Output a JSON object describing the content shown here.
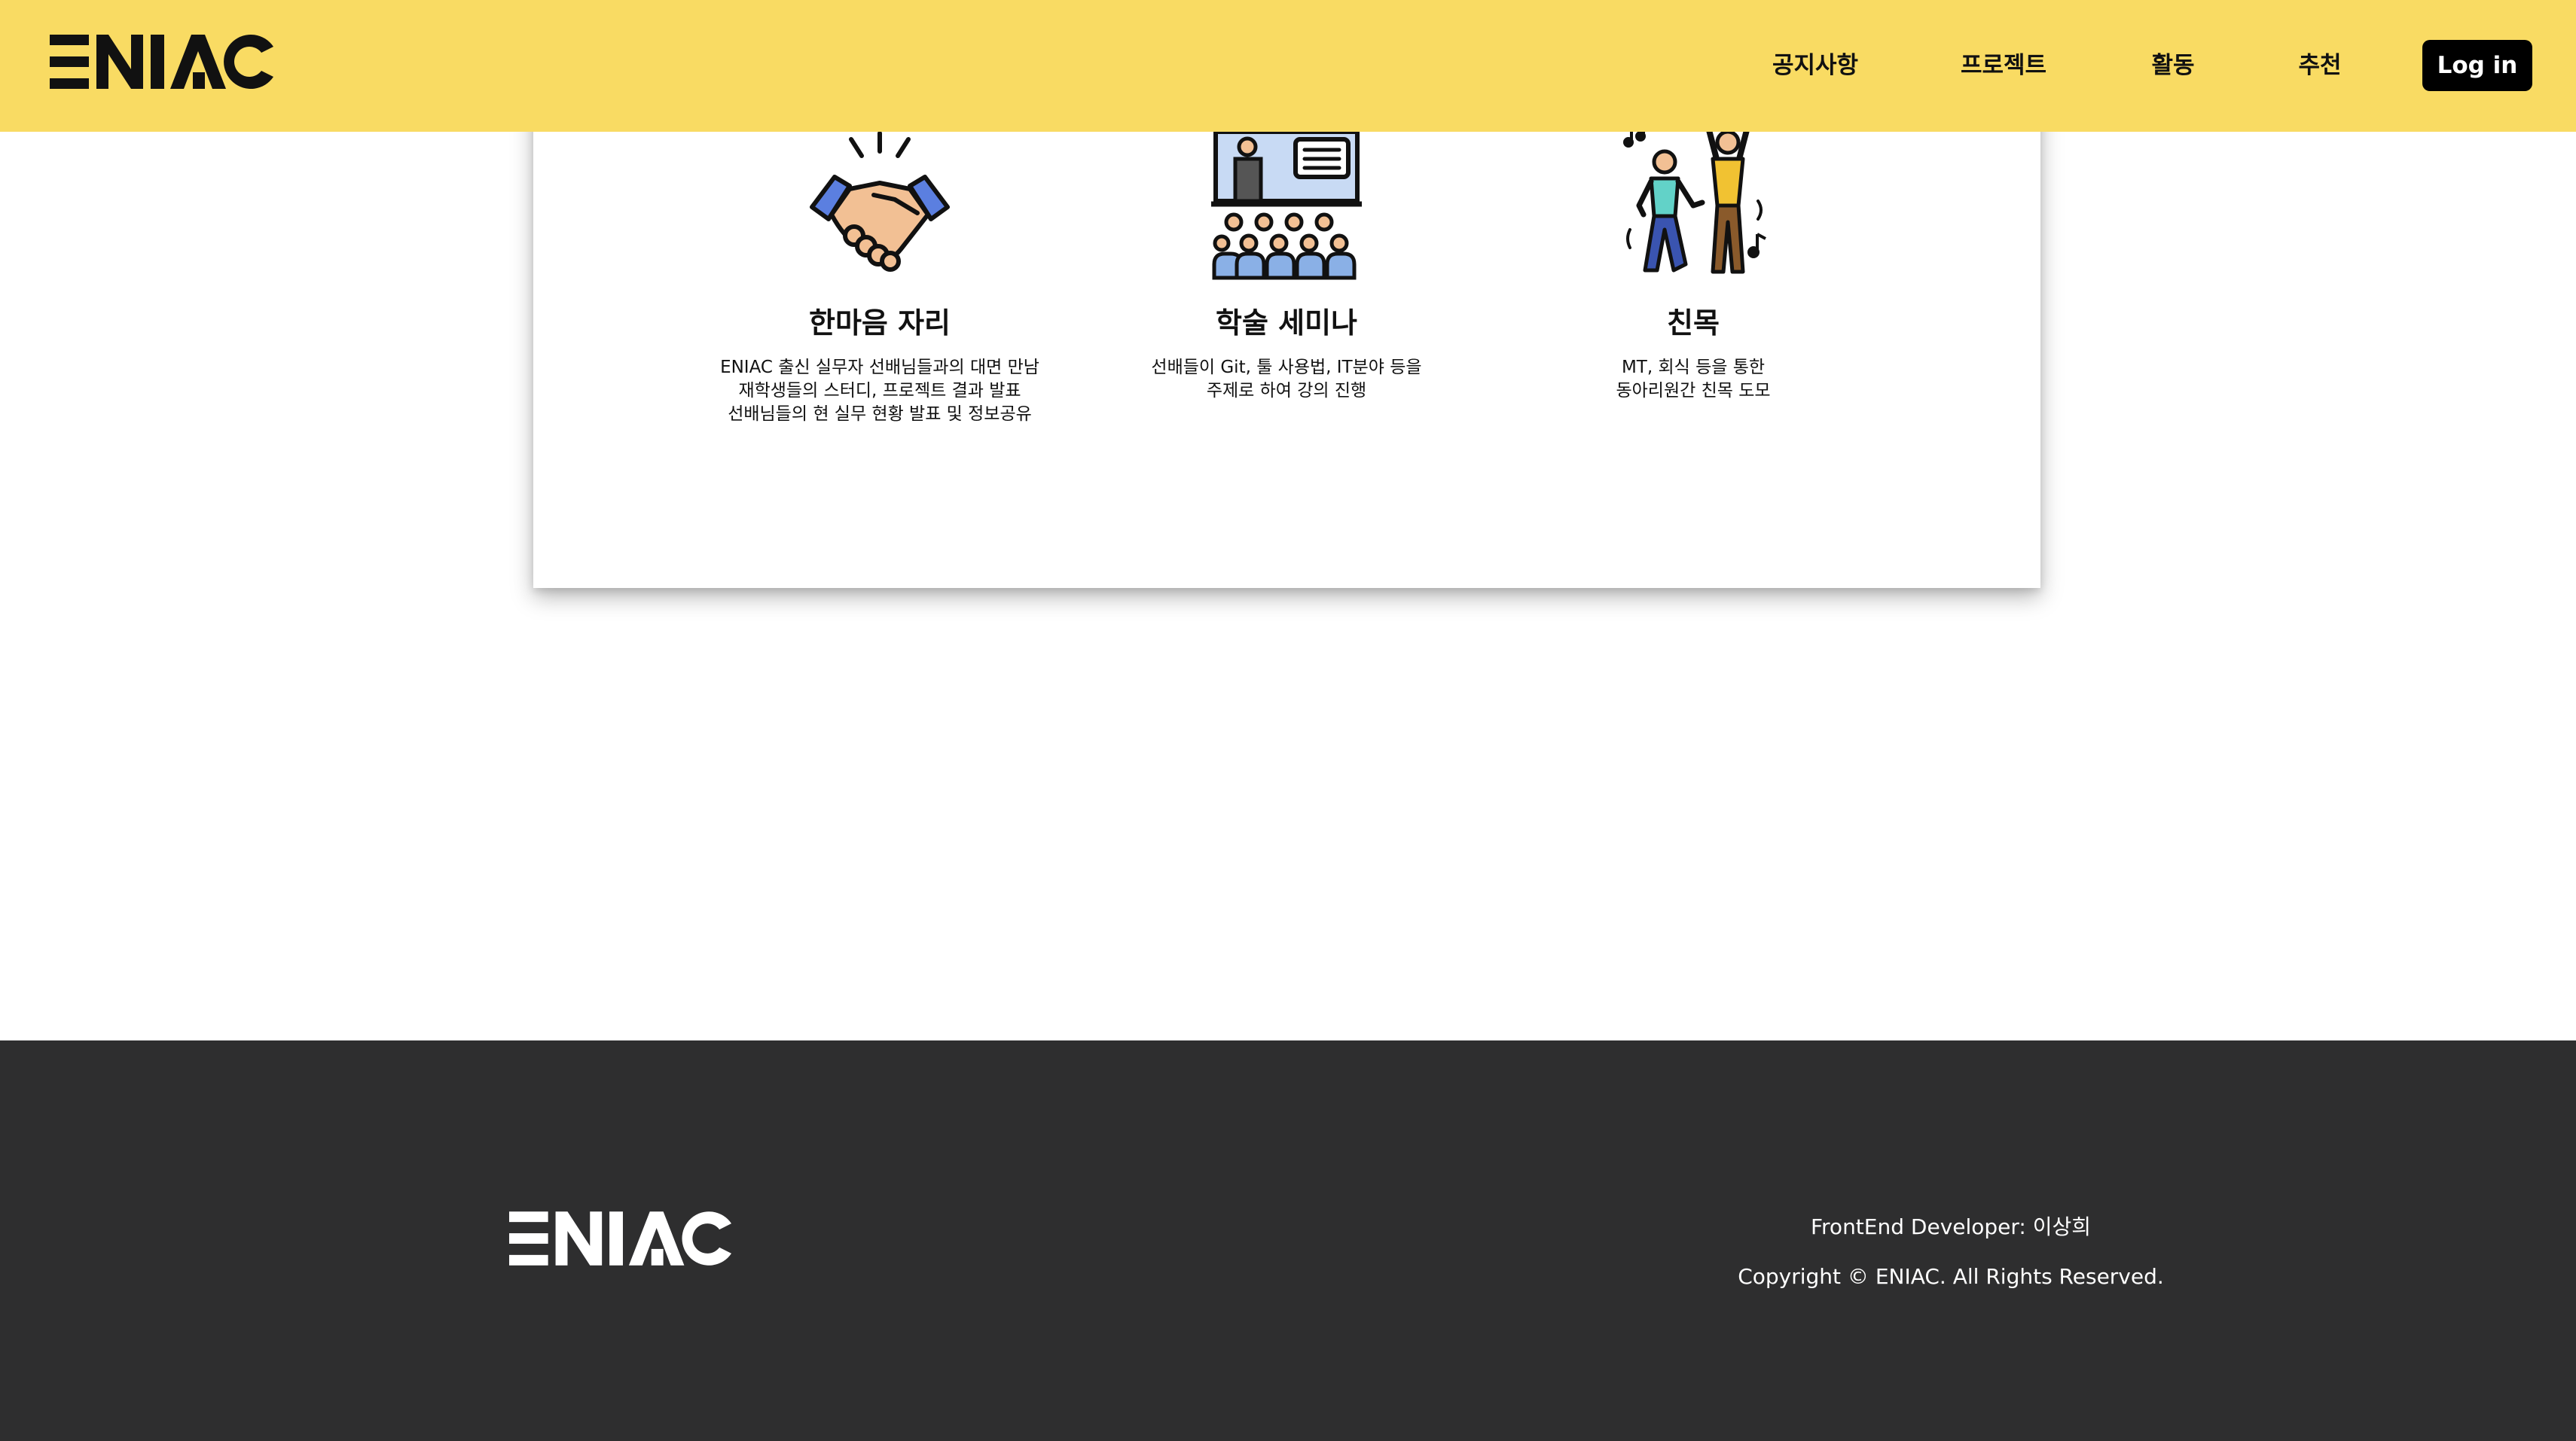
{
  "header": {
    "logo_text": "ENIAC",
    "nav": [
      "공지사항",
      "프로젝트",
      "활동",
      "추천"
    ],
    "login_label": "Log in",
    "background": "#f9db63"
  },
  "activities": [
    {
      "icon": "handshake-icon",
      "title": "한마음 자리",
      "description": "ENIAC 출신 실무자 선배님들과의 대면 만남\n재학생들의 스터디, 프로젝트 결과 발표\n선배님들의 현 실무 현황 발표 및 정보공유"
    },
    {
      "icon": "seminar-icon",
      "title": "학술 세미나",
      "description": "선배들이 Git, 툴 사용법, IT분야 등을\n주제로 하여 강의 진행"
    },
    {
      "icon": "dancing-people-icon",
      "title": "친목",
      "description": "MT, 회식 등을 통한\n동아리원간 친목 도모"
    }
  ],
  "footer": {
    "logo_text": "ENIAC",
    "developer": "FrontEnd Developer: 이상희",
    "copyright": "Copyright © ENIAC. All Rights Reserved.",
    "background": "#2e2e2f"
  }
}
